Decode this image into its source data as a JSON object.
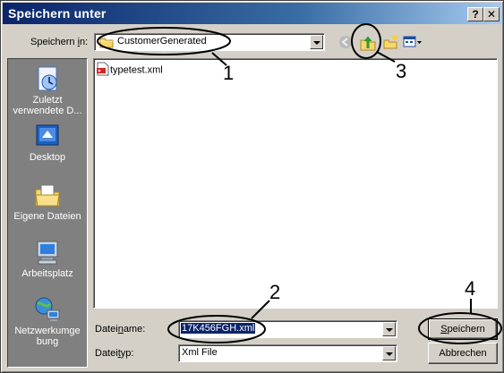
{
  "window": {
    "title": "Speichern unter"
  },
  "titlebar": {
    "help_label": "?",
    "close_label": "✕"
  },
  "save_in": {
    "label_pre": "Speichern ",
    "label_ul": "i",
    "label_post": "n:",
    "folder": "CustomerGenerated"
  },
  "toolbar": {
    "icons": [
      "back-icon",
      "up-folder-icon",
      "new-folder-icon",
      "view-menu-icon"
    ]
  },
  "places": [
    {
      "label_line1": "Zuletzt",
      "label_line2": "verwendete D...",
      "icon": "recent-documents-icon"
    },
    {
      "label_line1": "Desktop",
      "label_line2": "",
      "icon": "desktop-icon"
    },
    {
      "label_line1": "Eigene Dateien",
      "label_line2": "",
      "icon": "my-documents-icon"
    },
    {
      "label_line1": "Arbeitsplatz",
      "label_line2": "",
      "icon": "my-computer-icon"
    },
    {
      "label_line1": "Netzwerkumge",
      "label_line2": "bung",
      "icon": "network-places-icon"
    }
  ],
  "files": [
    {
      "name": "typetest.xml",
      "icon": "xml-file-icon"
    }
  ],
  "filename": {
    "label_pre": "Datei",
    "label_ul": "n",
    "label_post": "ame:",
    "value": "17K456FGH.xml"
  },
  "filetype": {
    "label_pre": "Datei",
    "label_ul": "t",
    "label_post": "yp:",
    "value": "Xml File"
  },
  "buttons": {
    "save_ul": "S",
    "save_rest": "peichern",
    "cancel": "Abbrechen"
  },
  "annotations": {
    "n1": "1",
    "n2": "2",
    "n3": "3",
    "n4": "4"
  }
}
